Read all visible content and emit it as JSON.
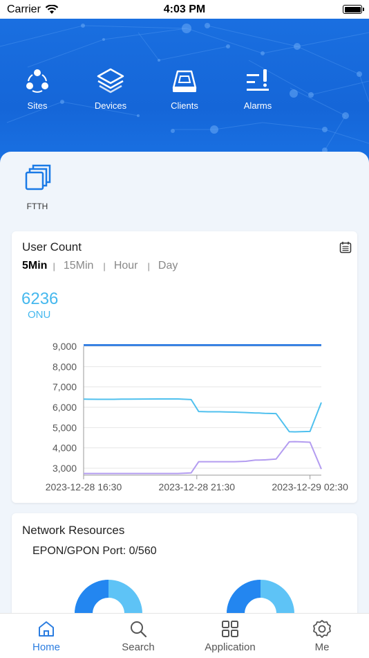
{
  "status_bar": {
    "carrier": "Carrier",
    "time": "4:03 PM"
  },
  "top_nav": [
    {
      "label": "Sites",
      "icon": "sites-icon"
    },
    {
      "label": "Devices",
      "icon": "devices-icon"
    },
    {
      "label": "Clients",
      "icon": "clients-icon"
    },
    {
      "label": "Alarms",
      "icon": "alarms-icon"
    }
  ],
  "shortcut": {
    "label": "FTTH",
    "icon": "ftth-icon"
  },
  "user_count": {
    "title": "User Count",
    "tabs": [
      "5Min",
      "15Min",
      "Hour",
      "Day"
    ],
    "active_tab": "5Min",
    "value": "6236",
    "unit": "ONU"
  },
  "chart_data": {
    "type": "line",
    "title": "",
    "xlabel": "",
    "ylabel": "",
    "ylim": [
      2700,
      9000
    ],
    "yticks": [
      "9,000",
      "8,000",
      "7,000",
      "6,000",
      "5,000",
      "4,000",
      "3,000"
    ],
    "xticks": [
      "2023-12-28 16:30",
      "2023-12-28 21:30",
      "2023-12-29 02:30"
    ],
    "grid": true,
    "legend": "none",
    "x": [
      0,
      0.4,
      0.8,
      1.0,
      1.2,
      2.0,
      2.5,
      2.85,
      3.05,
      3.3,
      3.6,
      3.75,
      4.0,
      4.3,
      4.55,
      4.65,
      4.8,
      5.1,
      5.45,
      5.6,
      5.75,
      6.0,
      6.3
    ],
    "series": [
      {
        "color": "#1a6fe0",
        "values": [
          9060,
          9060,
          9060,
          9060,
          9060,
          9060,
          9060,
          9060,
          9060,
          9060,
          9060,
          9060,
          9060,
          9060,
          9060,
          9060,
          9060,
          9060,
          9060,
          9060,
          9060,
          9060,
          9060
        ]
      },
      {
        "color": "#4fc0ee",
        "values": [
          6400,
          6390,
          6390,
          6400,
          6400,
          6410,
          6410,
          6380,
          5790,
          5780,
          5780,
          5770,
          5760,
          5740,
          5720,
          5720,
          5700,
          5690,
          4800,
          4790,
          4800,
          4810,
          6236
        ]
      },
      {
        "color": "#b39cf0",
        "values": [
          2740,
          2740,
          2740,
          2740,
          2740,
          2740,
          2740,
          2770,
          3320,
          3320,
          3320,
          3320,
          3320,
          3340,
          3400,
          3400,
          3410,
          3450,
          4300,
          4310,
          4300,
          4280,
          2960
        ]
      }
    ]
  },
  "network_resources": {
    "title": "Network Resources",
    "port_label": "EPON/GPON Port: 0/560"
  },
  "donut_colors": {
    "dark": "#2386f0",
    "light": "#5ec3f6"
  },
  "tab_bar": [
    {
      "label": "Home",
      "icon": "home-icon",
      "active": true
    },
    {
      "label": "Search",
      "icon": "search-icon",
      "active": false
    },
    {
      "label": "Application",
      "icon": "application-icon",
      "active": false
    },
    {
      "label": "Me",
      "icon": "settings-icon",
      "active": false
    }
  ]
}
